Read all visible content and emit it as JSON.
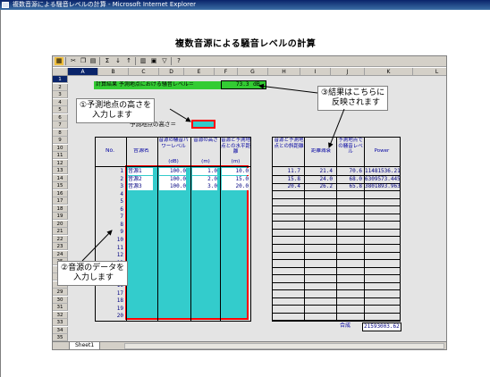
{
  "window": {
    "title": "複数音源による騒音レベルの計算 - Microsoft Internet Explorer"
  },
  "page": {
    "title": "複数音源による騒音レベルの計算"
  },
  "toolbar": {
    "icons": [
      "app-icon",
      "cut-icon",
      "copy-icon",
      "paste-icon",
      "sum-icon",
      "sort-asc-icon",
      "chart-icon",
      "format-icon",
      "help-icon"
    ]
  },
  "columns": [
    "A",
    "B",
    "C",
    "D",
    "E",
    "F",
    "G",
    "H",
    "I",
    "J",
    "K",
    "L"
  ],
  "rows": [
    "1",
    "2",
    "3",
    "4",
    "5",
    "6",
    "7",
    "8",
    "9",
    "10",
    "11",
    "12",
    "13",
    "14",
    "15",
    "16",
    "17",
    "18",
    "19",
    "20",
    "21",
    "22",
    "23",
    "24",
    "25",
    "26",
    "27",
    "28",
    "29",
    "30",
    "31",
    "32",
    "33",
    "34",
    "35"
  ],
  "result": {
    "label": "計算結果  予測地点における騒音レベル＝",
    "value": "73.3",
    "unit": "dB"
  },
  "input": {
    "label": "予測地点の高さ＝"
  },
  "table": {
    "headers": {
      "no": "No.",
      "name": "音源名",
      "power": "音源の騒音パワーレベル",
      "height": "音源の高さ",
      "dist": "音源と予測地点との水平距離",
      "unit_power": "(dB)",
      "unit_height": "(m)",
      "unit_dist": "(m)",
      "slant": "音源と予測地点との斜距離",
      "atten": "距離減衰",
      "level": "予測地点での騒音レベル",
      "pw": "Power"
    },
    "nos": [
      "1",
      "2",
      "3",
      "4",
      "5",
      "6",
      "7",
      "8",
      "9",
      "10",
      "11",
      "12",
      "13",
      "14",
      "15",
      "16",
      "17",
      "18",
      "19",
      "20"
    ],
    "sources": [
      {
        "name": "音源1",
        "power": "100.0",
        "height": "1.0",
        "dist": "10.0",
        "slant": "11.7",
        "atten": "21.4",
        "level": "70.6",
        "pw": "11481536.21"
      },
      {
        "name": "音源2",
        "power": "100.0",
        "height": "2.0",
        "dist": "15.0",
        "slant": "15.8",
        "atten": "24.0",
        "level": "68.0",
        "pw": "6309573.445"
      },
      {
        "name": "音源3",
        "power": "100.0",
        "height": "3.0",
        "dist": "20.0",
        "slant": "20.4",
        "atten": "26.2",
        "level": "65.8",
        "pw": "3801893.963"
      }
    ],
    "total_label": "合成",
    "total_value": "21593003.62"
  },
  "callouts": {
    "c1": [
      "①予測地点の高さを",
      "入力します"
    ],
    "c2": [
      "②音源のデータを",
      "入力します"
    ],
    "c3": [
      "③結果はこちらに",
      "反映されます"
    ]
  },
  "sheet": {
    "tab": "Sheet1"
  },
  "colors": {
    "result_green": "#33cc33",
    "input_cyan": "#33cccc",
    "highlight_red": "#ff0000",
    "titlebar": "#0a246a"
  }
}
